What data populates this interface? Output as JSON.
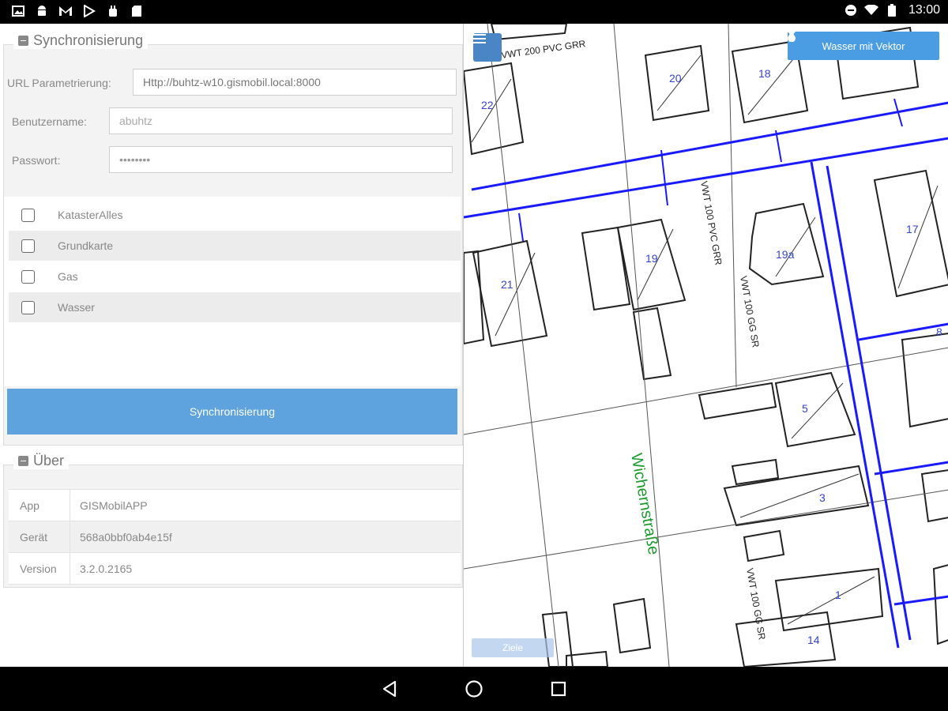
{
  "statusbar": {
    "left_icons": [
      "image-icon",
      "android-icon",
      "gmail-icon",
      "play-store-icon",
      "android-debug-icon",
      "sd-card-icon"
    ],
    "right_icons": [
      "do-not-disturb-icon",
      "wifi-icon",
      "battery-icon"
    ],
    "time": "13:00"
  },
  "sync": {
    "legend": "Synchronisierung",
    "url_label": "URL Parametrierung:",
    "url_value": "Http://buhtz-w10.gismobil.local:8000",
    "user_label": "Benutzername:",
    "user_value": "abuhtz",
    "pass_label": "Passwort:",
    "pass_value": "••••••••",
    "layers": [
      {
        "label": "KatasterAlles",
        "checked": false
      },
      {
        "label": "Grundkarte",
        "checked": false
      },
      {
        "label": "Gas",
        "checked": false
      },
      {
        "label": "Wasser",
        "checked": false
      }
    ],
    "button": "Synchronisierung"
  },
  "about": {
    "legend": "Über",
    "rows": [
      {
        "key": "App",
        "value": "GISMobilAPP"
      },
      {
        "key": "Gerät",
        "value": "568a0bbf0ab4e15f"
      },
      {
        "key": "Version",
        "value": "3.2.0.2165"
      }
    ]
  },
  "map": {
    "layer_button": "Wasser mit Vektor",
    "ghost_button": "Ziele",
    "street_name": "Wichernstraße",
    "pipe_labels": [
      "VWT 200 PVC GRR",
      "VWT 100 PVC GRR",
      "VWT 100 GG SR",
      "VWT 100 GG SR"
    ],
    "parcel_numbers": [
      "22",
      "20",
      "18",
      "21",
      "19",
      "19a",
      "17",
      "5",
      "3",
      "1",
      "14",
      "8"
    ],
    "colors": {
      "pipe": "#1a1aff",
      "parcel_number": "#3344cc",
      "street": "#1a9a2a",
      "lines": "#222222"
    }
  },
  "navbar": {
    "icons": [
      "back-icon",
      "home-icon",
      "recents-icon"
    ]
  }
}
